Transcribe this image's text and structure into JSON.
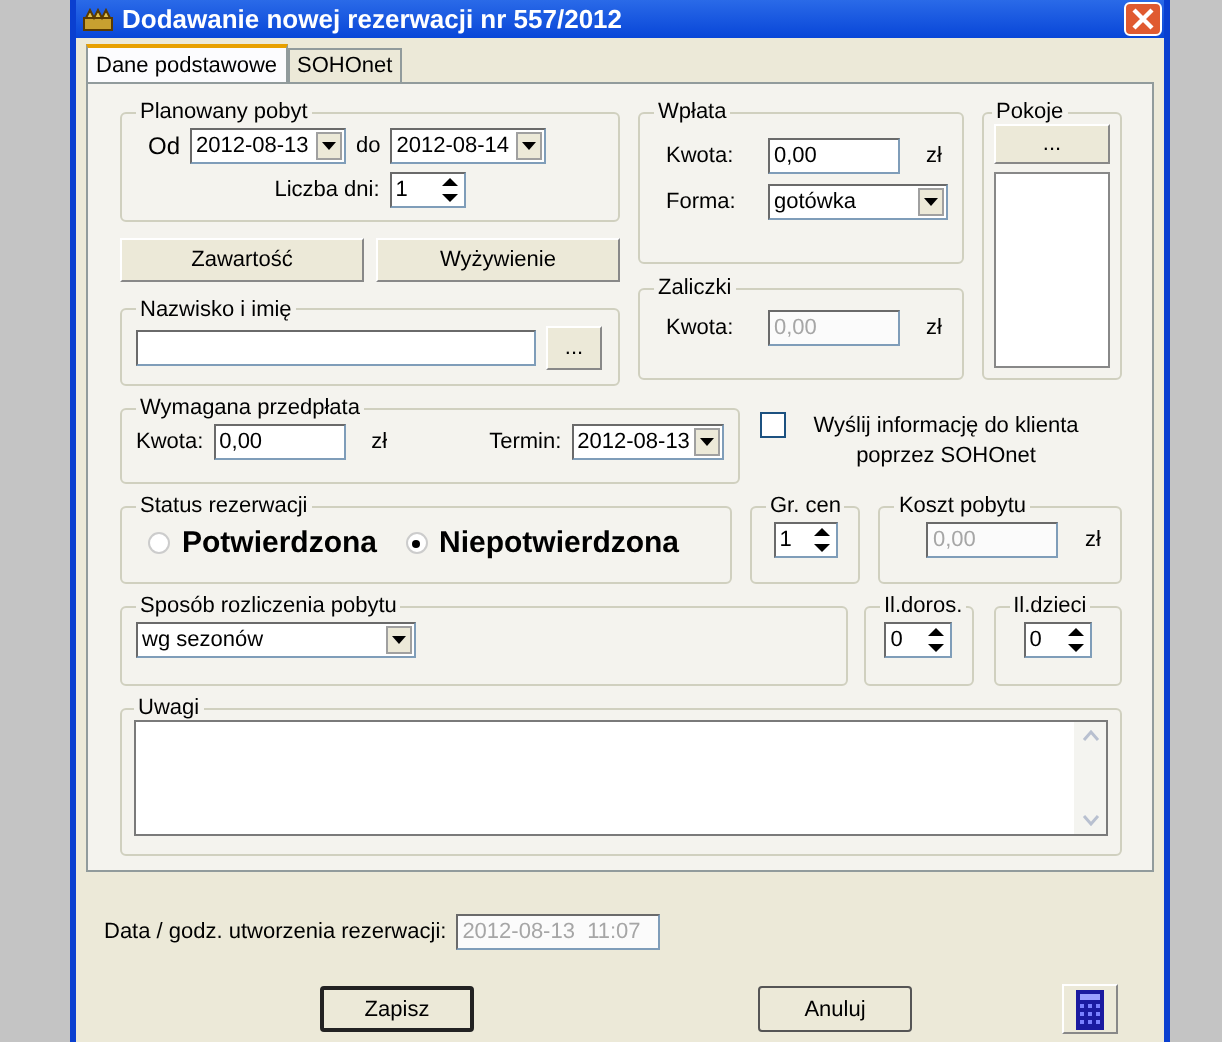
{
  "window": {
    "title": "Dodawanie nowej rezerwacji nr 557/2012"
  },
  "tabs": [
    {
      "label": "Dane podstawowe",
      "selected": true
    },
    {
      "label": "SOHOnet",
      "selected": false
    }
  ],
  "stay": {
    "title": "Planowany pobyt",
    "from_label": "Od",
    "from": "2012-08-13",
    "to_label": "do",
    "to": "2012-08-14",
    "days_label": "Liczba dni:",
    "days": "1"
  },
  "stay_buttons": [
    "Zawartość",
    "Wyżywienie"
  ],
  "guest": {
    "title": "Nazwisko i imię",
    "browse": "..."
  },
  "payment": {
    "title": "Wpłata",
    "amount_label": "Kwota:",
    "amount": "0,00",
    "currency": "zł",
    "form_label": "Forma:",
    "form": "gotówka"
  },
  "advances": {
    "title": "Zaliczki",
    "amount_label": "Kwota:",
    "amount": "0,00",
    "currency": "zł",
    "disabled": true
  },
  "rooms": {
    "title": "Pokoje",
    "button": "..."
  },
  "prepayment": {
    "title": "Wymagana przedpłata",
    "amount_label": "Kwota:",
    "amount": "0,00",
    "currency": "zł",
    "due_label": "Termin:",
    "due": "2012-08-13"
  },
  "notify": {
    "label": "Wyślij informację do klienta poprzez SOHOnet",
    "checked": false
  },
  "status": {
    "title": "Status rezerwacji",
    "options": [
      {
        "label": "Potwierdzona",
        "selected": false
      },
      {
        "label": "Niepotwierdzona",
        "selected": true
      }
    ]
  },
  "price_group": {
    "title": "Gr. cen",
    "value": "1"
  },
  "cost": {
    "title": "Koszt pobytu",
    "value": "0,00",
    "currency": "zł",
    "disabled": true
  },
  "billing": {
    "title": "Sposób rozliczenia pobytu",
    "value": "wg sezonów"
  },
  "adults": {
    "title": "Il.doros.",
    "value": "0"
  },
  "children": {
    "title": "Il.dzieci",
    "value": "0"
  },
  "notes": {
    "title": "Uwagi"
  },
  "created": {
    "label": "Data / godz. utworzenia rezerwacji:",
    "value": "2012-08-13  11:07",
    "disabled": true
  },
  "buttons": [
    {
      "label": "Zapisz",
      "default": true
    },
    {
      "label": "Anuluj",
      "default": false
    }
  ]
}
